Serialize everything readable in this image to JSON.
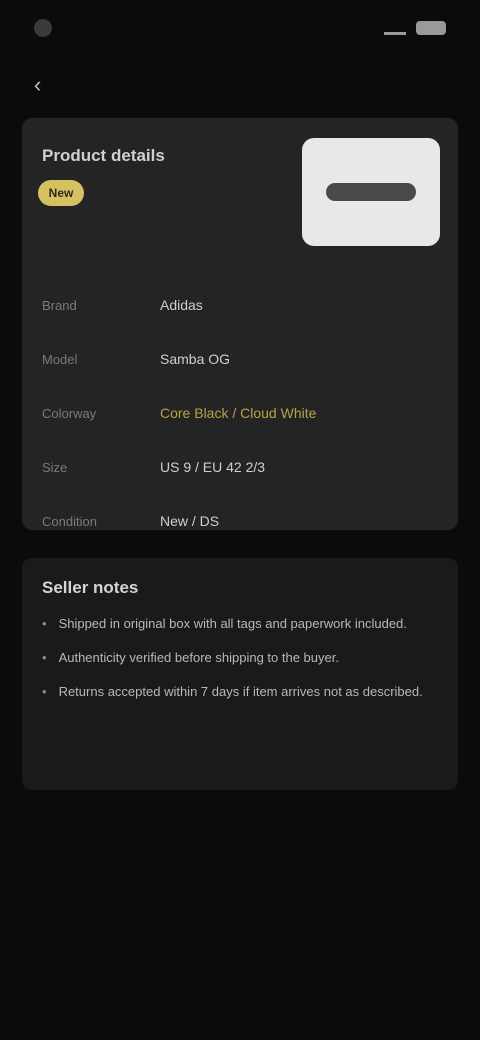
{
  "status_bar": {
    "time": ""
  },
  "detail": {
    "title": "Product details",
    "badge": "New",
    "rows": [
      {
        "label": "Brand",
        "value": "Adidas",
        "accent": false
      },
      {
        "label": "Model",
        "value": "Samba OG",
        "accent": false
      },
      {
        "label": "Colorway",
        "value": "Core Black / Cloud White",
        "accent": true
      },
      {
        "label": "Size",
        "value": "US 9 / EU 42 2/3",
        "accent": false
      },
      {
        "label": "Condition",
        "value": "New / DS",
        "accent": false
      }
    ]
  },
  "notes": {
    "title": "Seller notes",
    "items": [
      "Shipped in original box with all tags and paperwork included.",
      "Authenticity verified before shipping to the buyer.",
      "Returns accepted within 7 days if item arrives not as described."
    ]
  },
  "colors": {
    "background": "#0b0b0b",
    "card": "#242424",
    "accent": "#d6c162"
  }
}
